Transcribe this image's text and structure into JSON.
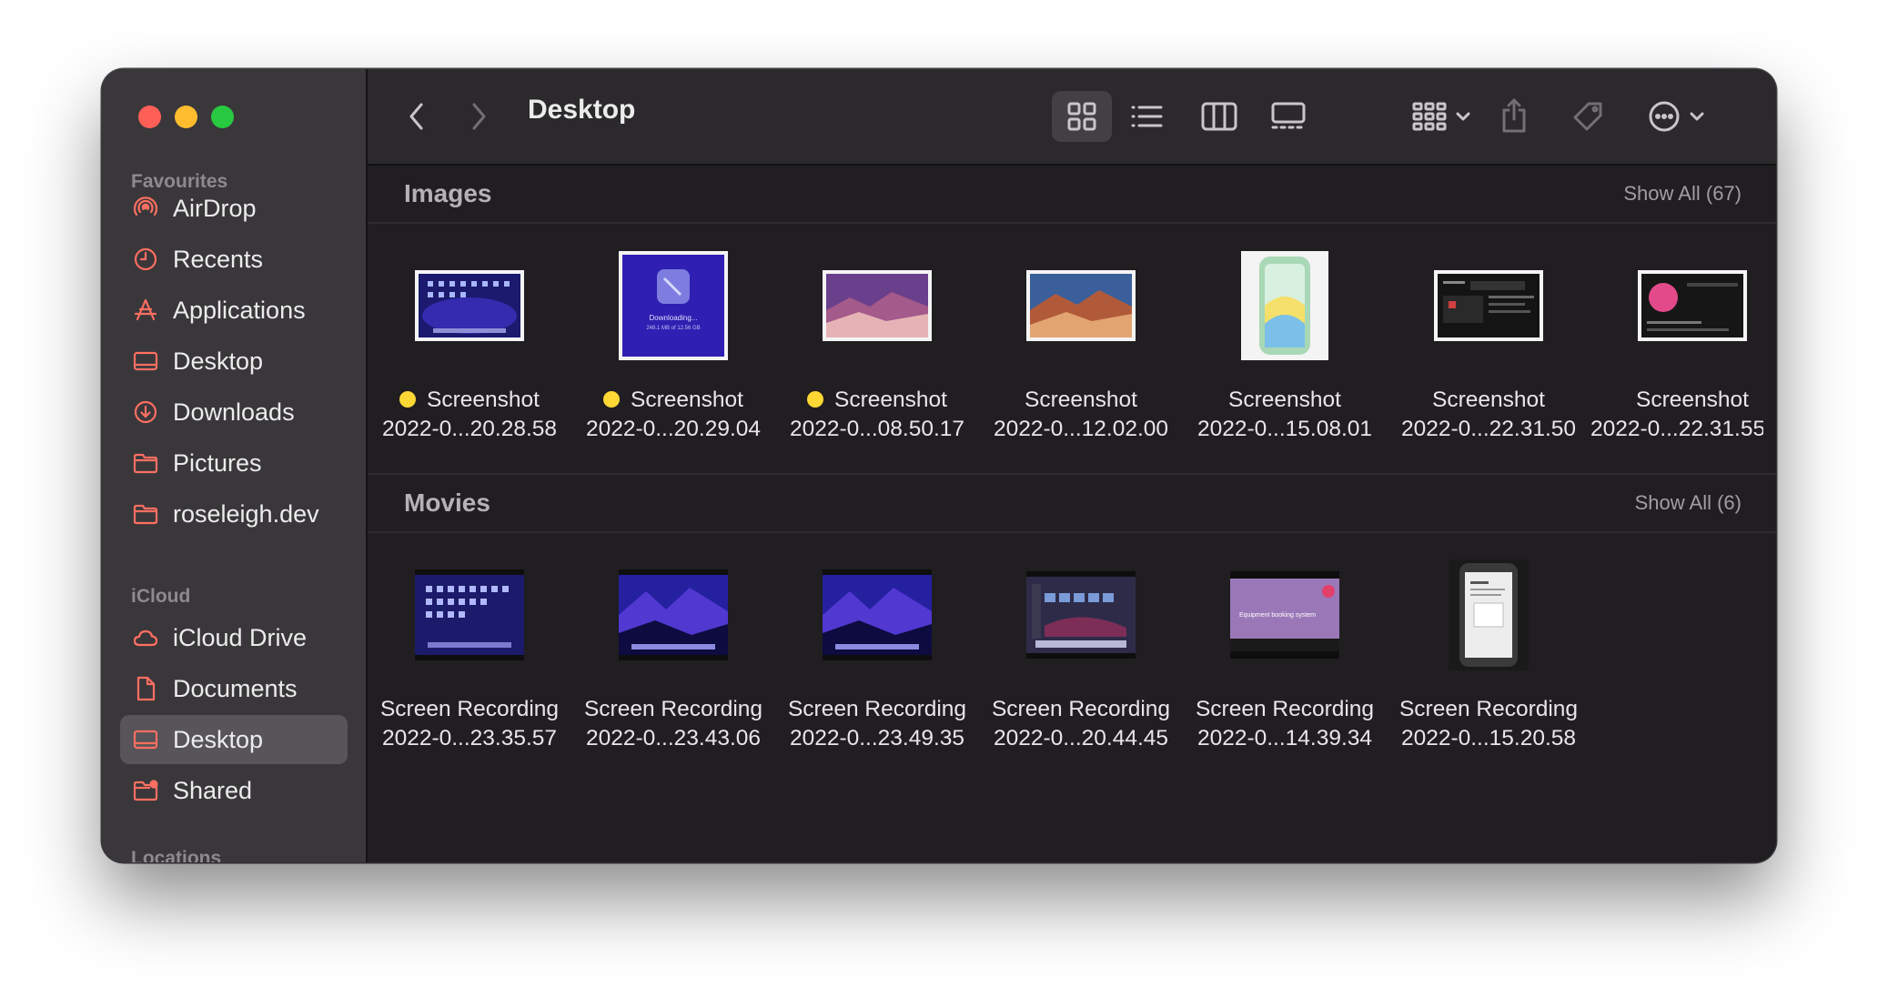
{
  "window": {
    "title": "Desktop"
  },
  "sidebar": {
    "sections": [
      {
        "title": "Favourites",
        "items": [
          {
            "label": "AirDrop",
            "icon": "airdrop-icon"
          },
          {
            "label": "Recents",
            "icon": "clock-icon"
          },
          {
            "label": "Applications",
            "icon": "applications-icon"
          },
          {
            "label": "Desktop",
            "icon": "desktop-icon"
          },
          {
            "label": "Downloads",
            "icon": "download-icon"
          },
          {
            "label": "Pictures",
            "icon": "folder-icon"
          },
          {
            "label": "roseleigh.dev",
            "icon": "folder-icon"
          }
        ]
      },
      {
        "title": "iCloud",
        "items": [
          {
            "label": "iCloud Drive",
            "icon": "cloud-icon"
          },
          {
            "label": "Documents",
            "icon": "document-icon"
          },
          {
            "label": "Desktop",
            "icon": "desktop-icon",
            "selected": true
          },
          {
            "label": "Shared",
            "icon": "shared-folder-icon"
          }
        ]
      },
      {
        "title": "Locations",
        "items": []
      }
    ]
  },
  "colors": {
    "accent": "#ff6f61",
    "tag_yellow": "#fdd835"
  },
  "sections": [
    {
      "title": "Images",
      "show_all": "Show All (67)",
      "items": [
        {
          "line1": "Screenshot",
          "line2": "2022-0...20.28.58",
          "tag": "yellow"
        },
        {
          "line1": "Screenshot",
          "line2": "2022-0...20.29.04",
          "tag": "yellow",
          "caption": "Downloading...",
          "caption2": "248.1 MB of 12.56 GB"
        },
        {
          "line1": "Screenshot",
          "line2": "2022-0...08.50.17",
          "tag": "yellow"
        },
        {
          "line1": "Screenshot",
          "line2": "2022-0...12.02.00"
        },
        {
          "line1": "Screenshot",
          "line2": "2022-0...15.08.01"
        },
        {
          "line1": "Screenshot",
          "line2": "2022-0...22.31.50"
        },
        {
          "line1": "Screenshot",
          "line2": "2022-0...22.31.55"
        }
      ]
    },
    {
      "title": "Movies",
      "show_all": "Show All (6)",
      "items": [
        {
          "line1": "Screen Recording",
          "line2": "2022-0...23.35.57"
        },
        {
          "line1": "Screen Recording",
          "line2": "2022-0...23.43.06"
        },
        {
          "line1": "Screen Recording",
          "line2": "2022-0...23.49.35"
        },
        {
          "line1": "Screen Recording",
          "line2": "2022-0...20.44.45"
        },
        {
          "line1": "Screen Recording",
          "line2": "2022-0...14.39.34",
          "caption": "Equipment booking system"
        },
        {
          "line1": "Screen Recording",
          "line2": "2022-0...15.20.58"
        }
      ]
    }
  ]
}
